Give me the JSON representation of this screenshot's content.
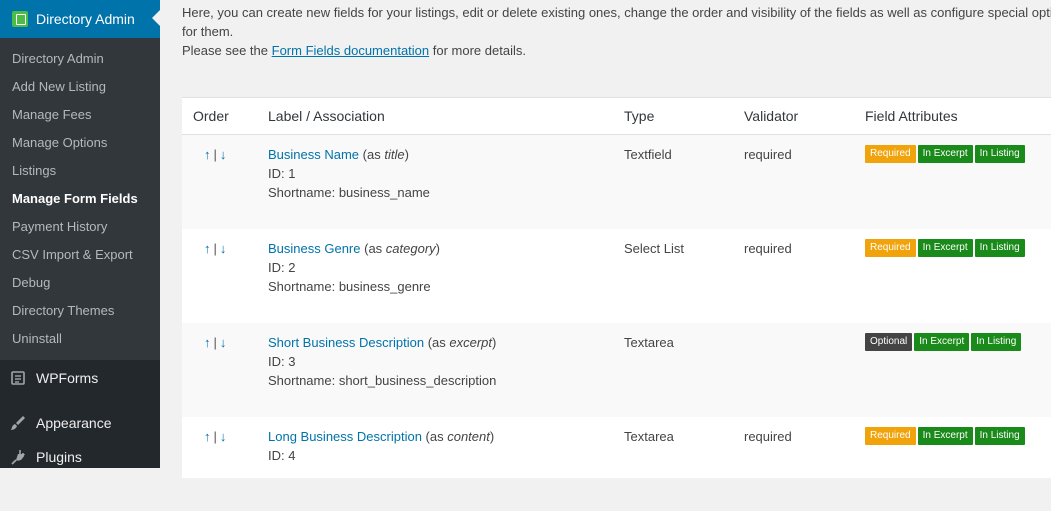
{
  "sidebar": {
    "active_menu": "Directory Admin",
    "submenu": [
      {
        "label": "Directory Admin"
      },
      {
        "label": "Add New Listing"
      },
      {
        "label": "Manage Fees"
      },
      {
        "label": "Manage Options"
      },
      {
        "label": "Listings"
      },
      {
        "label": "Manage Form Fields",
        "current": true
      },
      {
        "label": "Payment History"
      },
      {
        "label": "CSV Import & Export"
      },
      {
        "label": "Debug"
      },
      {
        "label": "Directory Themes"
      },
      {
        "label": "Uninstall"
      }
    ],
    "menu": [
      {
        "label": "WPForms",
        "icon": "wpforms-icon"
      },
      {
        "label": "Appearance",
        "icon": "paintbrush-icon"
      },
      {
        "label": "Plugins",
        "icon": "plugin-icon"
      }
    ]
  },
  "intro": {
    "line1": "Here, you can create new fields for your listings, edit or delete existing ones, change the order and visibility of the fields as well as configure special optio",
    "line2": "for them.",
    "line3_prefix": "Please see the ",
    "doc_link": "Form Fields documentation",
    "line3_suffix": " for more details."
  },
  "table": {
    "headers": {
      "order": "Order",
      "label": "Label / Association",
      "type": "Type",
      "validator": "Validator",
      "attributes": "Field Attributes"
    },
    "order_up": "↑",
    "order_sep": "|",
    "order_down": "↓",
    "rows": [
      {
        "name": "Business Name",
        "assoc_prefix": "(as ",
        "assoc": "title",
        "assoc_suffix": ")",
        "id": "ID: 1",
        "shortname": "Shortname: business_name",
        "type": "Textfield",
        "validator": "required",
        "badges": [
          {
            "text": "Required",
            "kind": "required"
          },
          {
            "text": "In Excerpt",
            "kind": "green"
          },
          {
            "text": "In Listing",
            "kind": "green"
          }
        ]
      },
      {
        "name": "Business Genre",
        "assoc_prefix": "(as ",
        "assoc": "category",
        "assoc_suffix": ")",
        "id": "ID: 2",
        "shortname": "Shortname: business_genre",
        "type": "Select List",
        "validator": "required",
        "badges": [
          {
            "text": "Required",
            "kind": "required"
          },
          {
            "text": "In Excerpt",
            "kind": "green"
          },
          {
            "text": "In Listing",
            "kind": "green"
          }
        ]
      },
      {
        "name": "Short Business Description",
        "assoc_prefix": "(as ",
        "assoc": "excerpt",
        "assoc_suffix": ")",
        "id": "ID: 3",
        "shortname": "Shortname: short_business_description",
        "type": "Textarea",
        "validator": "",
        "badges": [
          {
            "text": "Optional",
            "kind": "optional"
          },
          {
            "text": "In Excerpt",
            "kind": "green"
          },
          {
            "text": "In Listing",
            "kind": "green"
          }
        ]
      },
      {
        "name": "Long Business Description",
        "assoc_prefix": "(as ",
        "assoc": "content",
        "assoc_suffix": ")",
        "id": "ID: 4",
        "shortname": "",
        "type": "Textarea",
        "validator": "required",
        "badges": [
          {
            "text": "Required",
            "kind": "required"
          },
          {
            "text": "In Excerpt",
            "kind": "green"
          },
          {
            "text": "In Listing",
            "kind": "green"
          }
        ]
      }
    ]
  }
}
